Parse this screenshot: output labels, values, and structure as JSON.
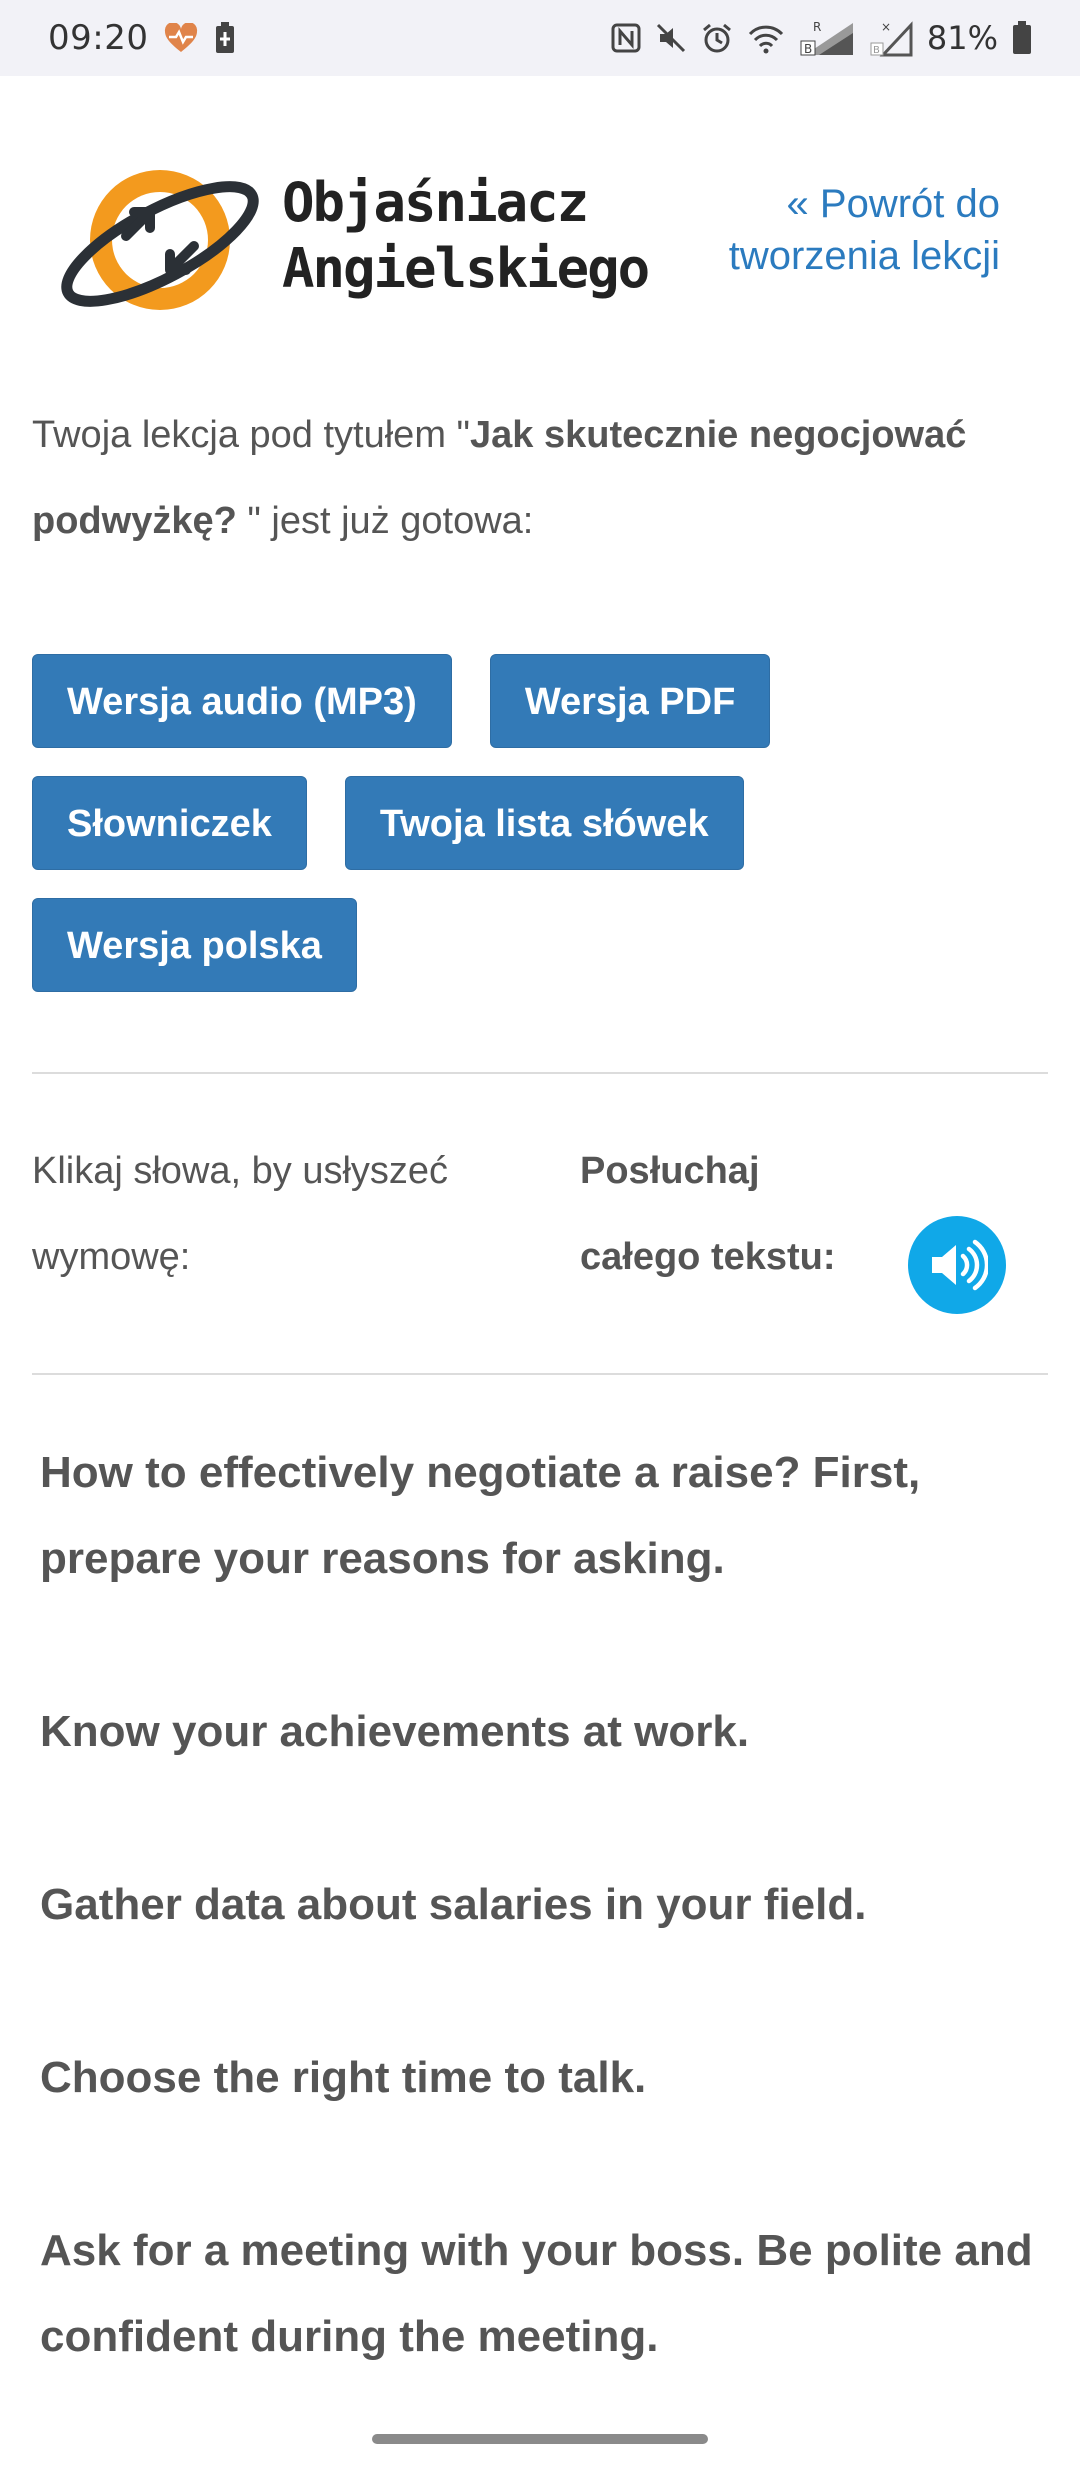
{
  "status_bar": {
    "time": "09:20",
    "battery_percent": "81%",
    "icons": [
      "heart-health-icon",
      "battery-saver-icon",
      "nfc-icon",
      "mute-icon",
      "alarm-icon",
      "wifi-icon",
      "signal-r-icon",
      "signal-x-icon",
      "battery-icon"
    ],
    "heart_color": "#e0844a"
  },
  "header": {
    "brand_line1": "Objaśniacz",
    "brand_line2": "Angielskiego",
    "back_link": "« Powrót do tworzenia lekcji",
    "logo_colors": {
      "ring": "#f39a1e",
      "dark": "#2b3036"
    }
  },
  "intro": {
    "prefix": "Twoja lekcja pod tytułem \"",
    "title": "Jak skutecznie negocjować podwyżkę? ",
    "suffix": "\" jest już gotowa:"
  },
  "buttons": {
    "audio": "Wersja audio (MP3)",
    "pdf": "Wersja PDF",
    "glossary": "Słowniczek",
    "word_list": "Twoja lista słówek",
    "polish": "Wersja polska",
    "color": "#337ab7"
  },
  "audio_section": {
    "click_words": "Klikaj słowa, by usłyszeć wymowę:",
    "listen_label": "Posłuchaj całego tekstu:",
    "speaker_icon": "speaker-icon",
    "speaker_color": "#10a8e8"
  },
  "lesson": {
    "paragraphs": [
      "How to effectively negotiate a raise? First, prepare your reasons for asking.",
      "Know your achievements at work.",
      "Gather data about salaries in your field.",
      "Choose the right time to talk.",
      "Ask for a meeting with your boss. Be polite and confident during the meeting."
    ]
  }
}
